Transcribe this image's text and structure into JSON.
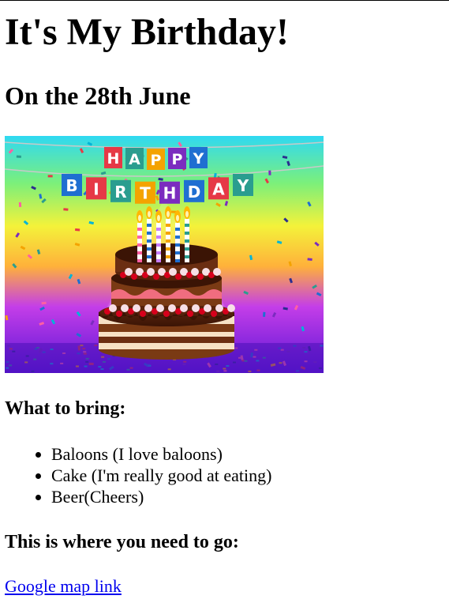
{
  "title": "It's My Birthday!",
  "date_heading": "On the 28th June",
  "image": {
    "banner_row1": [
      "H",
      "A",
      "P",
      "P",
      "Y"
    ],
    "banner_row2": [
      "B",
      "I",
      "R",
      "T",
      "H",
      "D",
      "A",
      "Y"
    ],
    "flag_colors": [
      "#1f6fd1",
      "#e63946",
      "#2a9d8f",
      "#f4a300",
      "#7b2cbf"
    ]
  },
  "bring_heading": "What to bring:",
  "bring_items": [
    "Baloons (I love baloons)",
    "Cake (I'm really good at eating)",
    "Beer(Cheers)"
  ],
  "where_heading": "This is where you need to go:",
  "map_link_text": "Google map link"
}
